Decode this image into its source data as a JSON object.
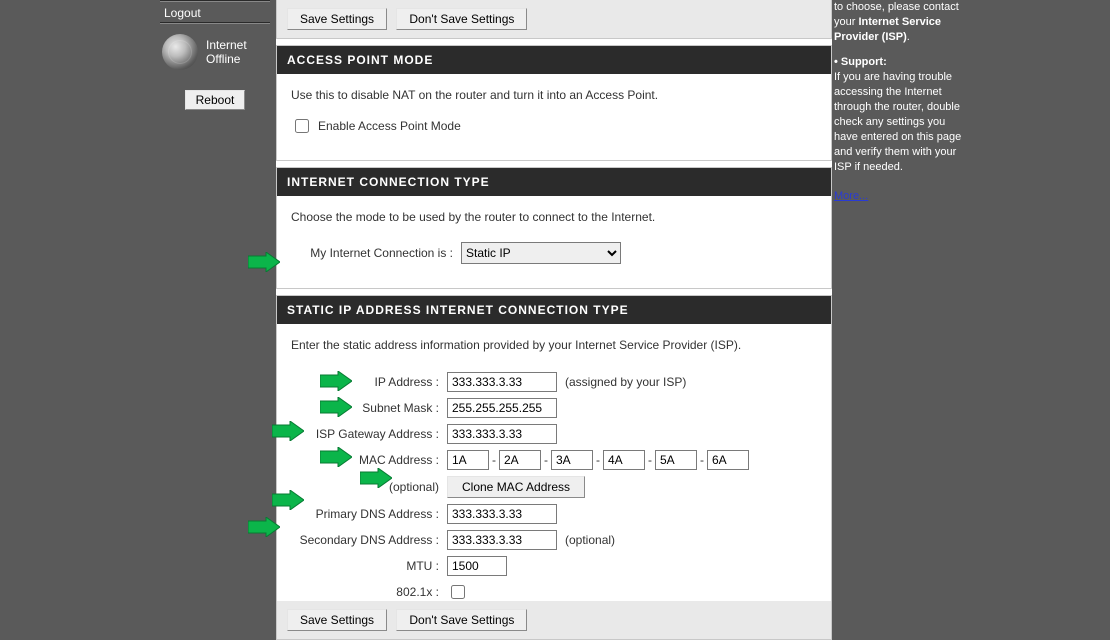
{
  "sidebar": {
    "logout": "Logout",
    "status_line1": "Internet",
    "status_line2": "Offline",
    "reboot": "Reboot"
  },
  "toolbar": {
    "save": "Save Settings",
    "dont_save": "Don't Save Settings"
  },
  "apm": {
    "title": "ACCESS POINT MODE",
    "desc": "Use this to disable NAT on the router and turn it into an Access Point.",
    "checkbox_label": "Enable Access Point Mode"
  },
  "ict": {
    "title": "INTERNET CONNECTION TYPE",
    "desc": "Choose the mode to be used by the router to connect to the Internet.",
    "label": "My Internet Connection is :",
    "selected": "Static IP"
  },
  "static": {
    "title": "STATIC IP ADDRESS INTERNET CONNECTION TYPE",
    "desc": "Enter the static address information provided by your Internet Service Provider (ISP).",
    "ip_label": "IP Address :",
    "ip_value": "333.333.3.33",
    "ip_hint": "(assigned by your ISP)",
    "mask_label": "Subnet Mask :",
    "mask_value": "255.255.255.255",
    "gw_label": "ISP Gateway Address :",
    "gw_value": "333.333.3.33",
    "mac_label": "MAC Address :",
    "mac": [
      "1A",
      "2A",
      "3A",
      "4A",
      "5A",
      "6A"
    ],
    "mac_optional": "(optional)",
    "clone_btn": "Clone MAC Address",
    "dns1_label": "Primary DNS Address :",
    "dns1_value": "333.333.3.33",
    "dns2_label": "Secondary DNS Address :",
    "dns2_value": "333.333.3.33",
    "dns2_hint": "(optional)",
    "mtu_label": "MTU :",
    "mtu_value": "1500",
    "dot1x_label": "802.1x :"
  },
  "help": {
    "p1a": "to choose, please contact your ",
    "p1b": "Internet Service Provider (ISP)",
    "p1c": ".",
    "bullet": "•  Support:",
    "p2": "If you are having trouble accessing the Internet through the router, double check any settings you have entered on this page and verify them with your ISP if needed.",
    "more": "More..."
  }
}
